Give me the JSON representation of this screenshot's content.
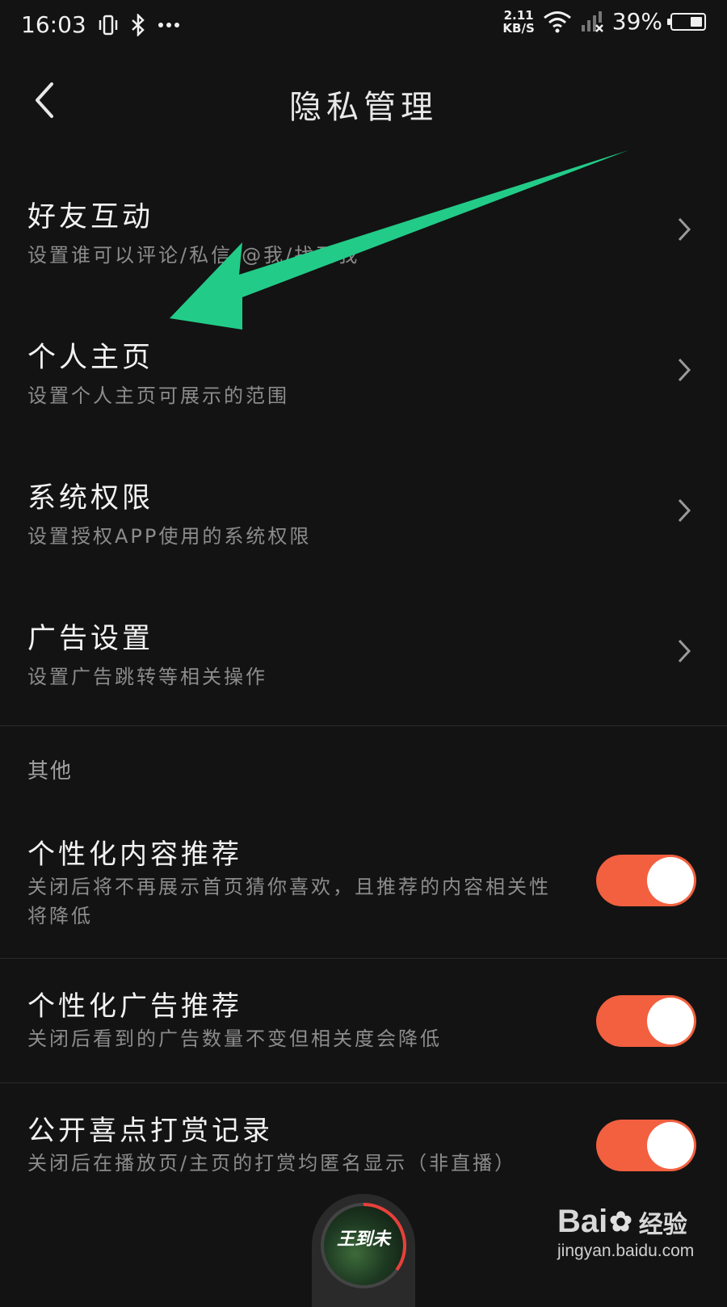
{
  "status_bar": {
    "time": "16:03",
    "icons": [
      "vibrate-icon",
      "bluetooth-icon",
      "more-dots-icon",
      "wifi-icon",
      "signal-icon"
    ],
    "net_speed_value": "2.11",
    "net_speed_unit": "KB/S",
    "battery_percent": "39%"
  },
  "header": {
    "title": "隐私管理",
    "back_icon": "chevron-left-icon"
  },
  "menu": [
    {
      "title": "好友互动",
      "subtitle": "设置谁可以评论/私信/@我/找到我"
    },
    {
      "title": "个人主页",
      "subtitle": "设置个人主页可展示的范围"
    },
    {
      "title": "系统权限",
      "subtitle": "设置授权APP使用的系统权限"
    },
    {
      "title": "广告设置",
      "subtitle": "设置广告跳转等相关操作"
    }
  ],
  "other_section": {
    "label": "其他",
    "toggles": [
      {
        "title": "个性化内容推荐",
        "subtitle": "关闭后将不再展示首页猜你喜欢，且推荐的内容相关性将降低",
        "on": true
      },
      {
        "title": "个性化广告推荐",
        "subtitle": "关闭后看到的广告数量不变但相关度会降低",
        "on": true
      },
      {
        "title": "公开喜点打赏记录",
        "subtitle": "关闭后在播放页/主页的打赏均匿名显示（非直播）",
        "on": true
      }
    ]
  },
  "player": {
    "cover_text": "王到未",
    "progress": 0.35
  },
  "watermark": {
    "logo": "Bai",
    "logo_tail": "经验",
    "url": "jingyan.baidu.com"
  },
  "colors": {
    "background": "#131313",
    "toggle_on": "#f2603f",
    "annotation_arrow": "#22cc88"
  }
}
